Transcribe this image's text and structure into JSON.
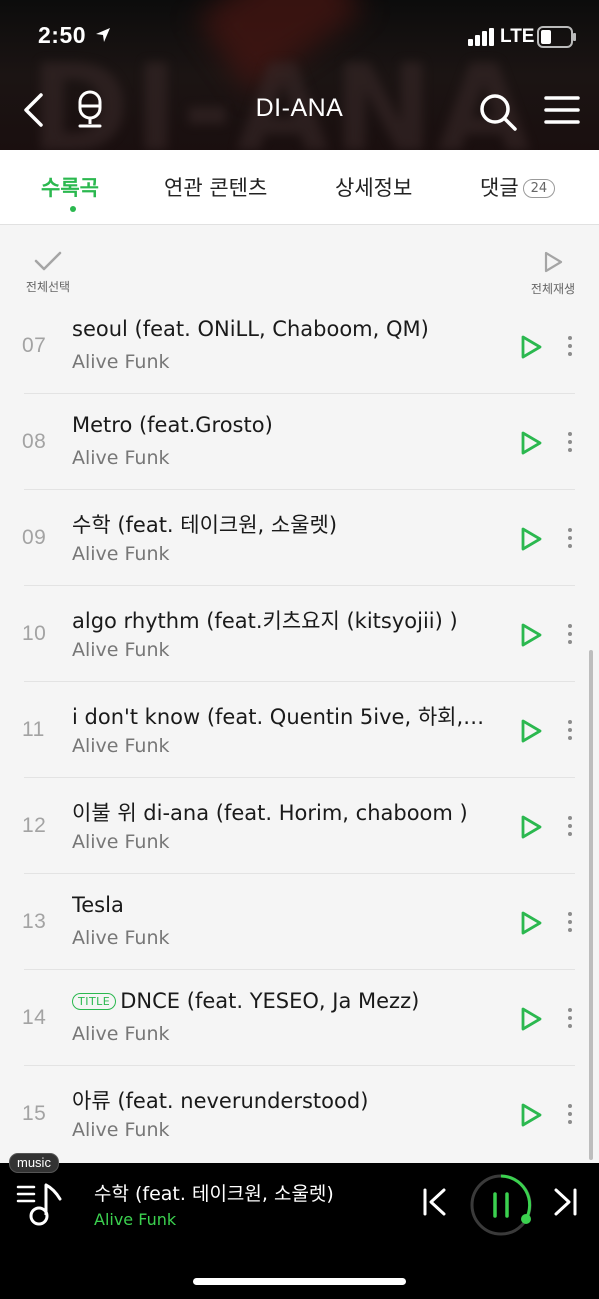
{
  "status_bar": {
    "time": "2:50",
    "network": "LTE"
  },
  "header": {
    "title": "DI-ANA"
  },
  "tabs": [
    {
      "label": "수록곡",
      "active": true
    },
    {
      "label": "연관 콘텐츠",
      "active": false
    },
    {
      "label": "상세정보",
      "active": false
    },
    {
      "label": "댓글",
      "badge": "24",
      "active": false
    }
  ],
  "toolbar": {
    "select_all": "전체선택",
    "play_all": "전체재생"
  },
  "tracks": [
    {
      "number": "07",
      "title": "seoul (feat. ONiLL, Chaboom, QM)",
      "artist": "Alive Funk"
    },
    {
      "number": "08",
      "title": "Metro (feat.Grosto)",
      "artist": "Alive Funk"
    },
    {
      "number": "09",
      "title": "수학 (feat. 테이크원, 소울렛)",
      "artist": "Alive Funk"
    },
    {
      "number": "10",
      "title": "algo rhythm (feat.키츠요지 (kitsyojii) )",
      "artist": "Alive Funk"
    },
    {
      "number": "11",
      "title": "i don't know (feat. Quentin 5ive, 하회,…",
      "artist": "Alive Funk"
    },
    {
      "number": "12",
      "title": "이불 위 di-ana (feat. Horim, chaboom )",
      "artist": "Alive Funk"
    },
    {
      "number": "13",
      "title": "Tesla",
      "artist": "Alive Funk"
    },
    {
      "number": "14",
      "title": "DNCE (feat. YESEO, Ja Mezz)",
      "artist": "Alive Funk",
      "tag": "TITLE"
    },
    {
      "number": "15",
      "title": "아류 (feat. neverunderstood)",
      "artist": "Alive Funk"
    }
  ],
  "player": {
    "label": "music",
    "now_playing_title": "수학 (feat. 테이크원, 소울렛)",
    "now_playing_artist": "Alive Funk",
    "progress": 0.12,
    "state": "playing"
  },
  "colors": {
    "accent": "#2bb84f",
    "player_bg": "#000000",
    "header_bg": "#141010"
  }
}
